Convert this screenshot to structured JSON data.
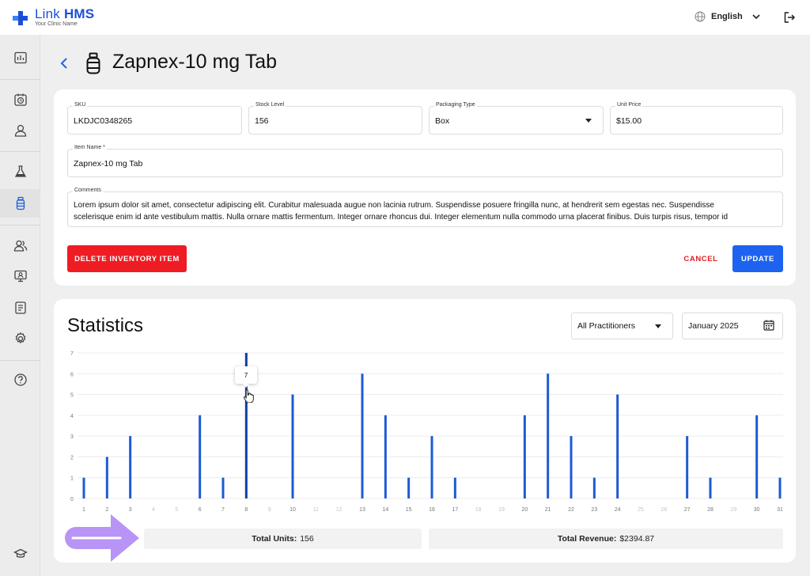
{
  "app": {
    "name_light": "Link",
    "name_bold": "HMS",
    "subtitle": "Your Clinic Name",
    "brand_color": "#1d4ed8"
  },
  "topbar": {
    "language": "English",
    "globe_icon": "globe-icon",
    "logout_icon": "logout-icon"
  },
  "sidebar": {
    "items": [
      {
        "icon": "dashboard-icon",
        "active": false
      },
      {
        "icon": "calendar-clock-icon",
        "active": false
      },
      {
        "icon": "user-icon",
        "active": false
      },
      {
        "icon": "lab-flask-icon",
        "active": false
      },
      {
        "icon": "medicine-bottle-icon",
        "active": true
      },
      {
        "icon": "users-icon",
        "active": false
      },
      {
        "icon": "monitor-user-icon",
        "active": false
      },
      {
        "icon": "report-icon",
        "active": false
      },
      {
        "icon": "settings-icon",
        "active": false
      },
      {
        "icon": "help-icon",
        "active": false
      },
      {
        "icon": "graduation-cap-icon",
        "active": false
      }
    ]
  },
  "page": {
    "title": "Zapnex-10 mg Tab"
  },
  "form": {
    "sku": {
      "label": "SKU",
      "value": "LKDJC0348265"
    },
    "stock": {
      "label": "Stock Level",
      "value": "156"
    },
    "packaging": {
      "label": "Packaging Type",
      "value": "Box"
    },
    "price": {
      "label": "Unit Price",
      "value": "$15.00"
    },
    "item_name": {
      "label": "Item Name *",
      "value": "Zapnex-10 mg Tab"
    },
    "comments": {
      "label": "Comments",
      "line1": "Lorem ipsum dolor sit amet, consectetur adipiscing elit. Curabitur malesuada augue non lacinia rutrum. Suspendisse posuere fringilla nunc, at hendrerit sem egestas nec. Suspendisse",
      "line2": "scelerisque enim id ante vestibulum mattis. Nulla ornare mattis fermentum. Integer ornare rhoncus dui. Integer elementum nulla commodo urna placerat finibus. Duis turpis risus, tempor id"
    },
    "delete_label": "DELETE INVENTORY ITEM",
    "cancel_label": "CANCEL",
    "update_label": "UPDATE"
  },
  "stats": {
    "title": "Statistics",
    "practitioner": "All Practitioners",
    "month": "January 2025",
    "tooltip_value": "7",
    "total_units_label": "Total Units:",
    "total_units": "156",
    "total_revenue_label": "Total Revenue:",
    "total_revenue": "$2394.87"
  },
  "chart_data": {
    "type": "bar",
    "categories": [
      "1",
      "2",
      "3",
      "4",
      "5",
      "6",
      "7",
      "8",
      "9",
      "10",
      "11",
      "12",
      "13",
      "14",
      "15",
      "16",
      "17",
      "18",
      "19",
      "20",
      "21",
      "22",
      "23",
      "24",
      "25",
      "26",
      "27",
      "28",
      "29",
      "30",
      "31"
    ],
    "values": [
      1,
      2,
      3,
      0,
      0,
      4,
      1,
      7,
      0,
      5,
      0,
      0,
      6,
      4,
      1,
      3,
      1,
      0,
      0,
      4,
      6,
      3,
      1,
      5,
      0,
      0,
      3,
      1,
      0,
      4,
      1
    ],
    "ylim": [
      0,
      7
    ],
    "yticks": [
      0,
      1,
      2,
      3,
      4,
      5,
      6,
      7
    ],
    "grid": true,
    "highlighted_category": "8",
    "bar_color": "#1d5ad6",
    "highlight_color": "#0d3fa8"
  }
}
